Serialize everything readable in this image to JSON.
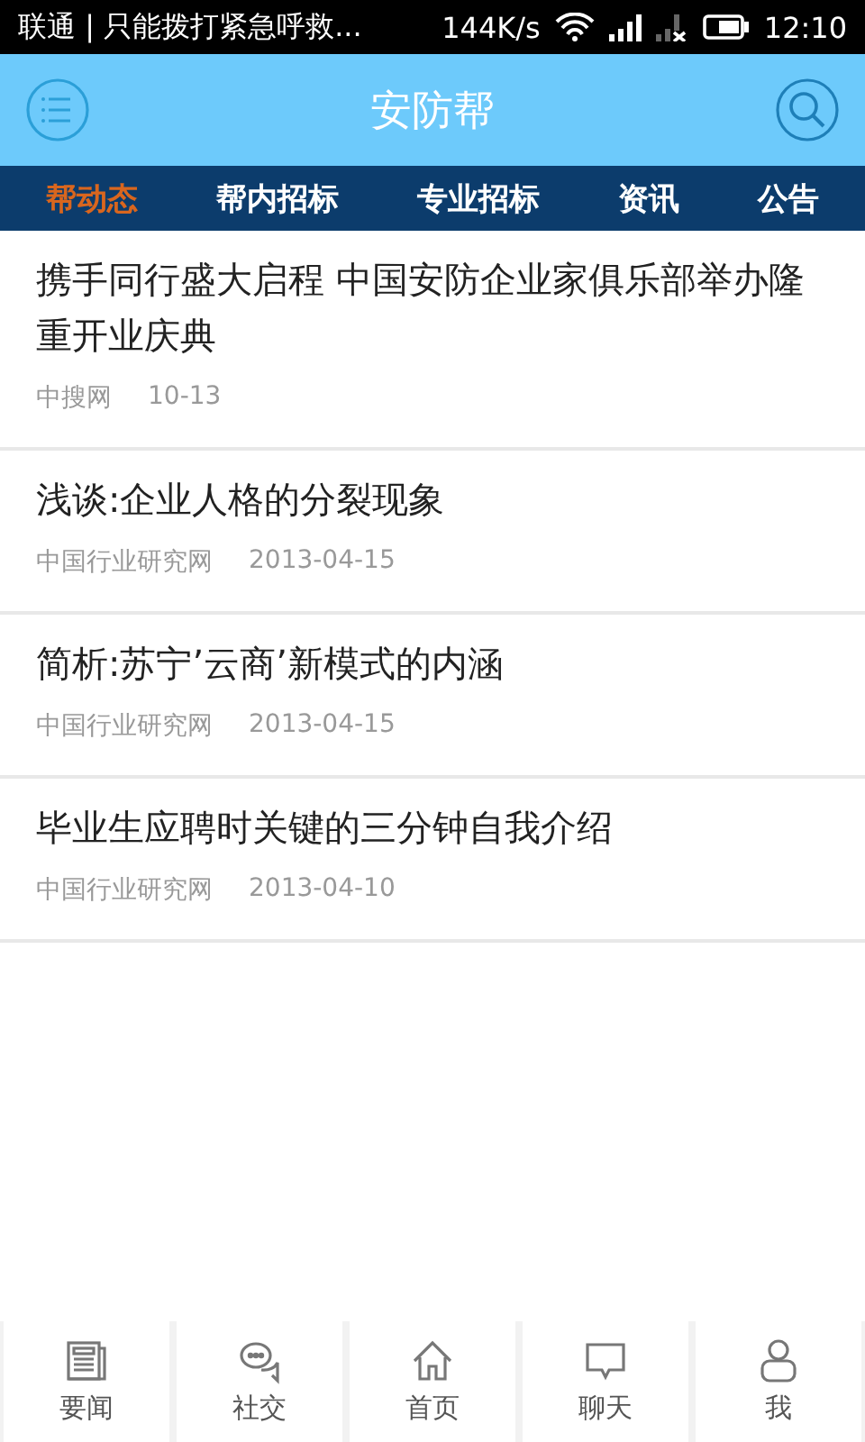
{
  "status_bar": {
    "carrier": "联通 | 只能拨打紧急呼救...",
    "speed": "144K/s",
    "time": "12:10"
  },
  "header": {
    "title": "安防帮"
  },
  "tabs": [
    {
      "label": "帮动态",
      "selected": true
    },
    {
      "label": "帮内招标",
      "selected": false
    },
    {
      "label": "专业招标",
      "selected": false
    },
    {
      "label": "资讯",
      "selected": false
    },
    {
      "label": "公告",
      "selected": false
    }
  ],
  "articles": [
    {
      "title": "携手同行盛大启程 中国安防企业家俱乐部举办隆重开业庆典",
      "source": "中搜网",
      "date": "10-13"
    },
    {
      "title": "浅谈:企业人格的分裂现象",
      "source": "中国行业研究网",
      "date": "2013-04-15"
    },
    {
      "title": "简析:苏宁’云商’新模式的内涵",
      "source": "中国行业研究网",
      "date": "2013-04-15"
    },
    {
      "title": "毕业生应聘时关键的三分钟自我介绍",
      "source": "中国行业研究网",
      "date": "2013-04-10"
    }
  ],
  "bottom_nav": [
    {
      "label": "要闻",
      "kind": "news"
    },
    {
      "label": "社交",
      "kind": "social"
    },
    {
      "label": "首页",
      "kind": "home"
    },
    {
      "label": "聊天",
      "kind": "chat"
    },
    {
      "label": "我",
      "kind": "me"
    }
  ]
}
